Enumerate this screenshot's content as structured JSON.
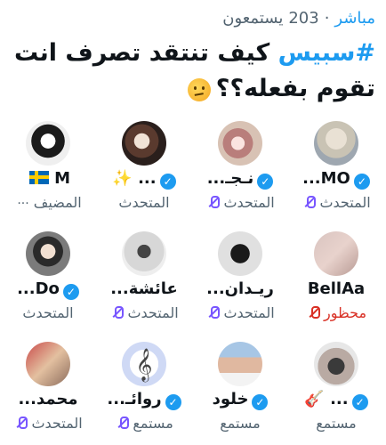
{
  "header": {
    "live_label": "مباشر",
    "separator": "·",
    "listener_count": "203",
    "listener_label": "يستمعون"
  },
  "title": {
    "hashtag": "#سبيس",
    "text_line1": " كيف تنتقد تصرف انت",
    "text_line2": "تقوم بفعله؟؟"
  },
  "participants": [
    {
      "name": "M",
      "badge": "flag-sweden",
      "role": "المضيف",
      "role_icon": "more-icon"
    },
    {
      "name": "...",
      "badge": "verified",
      "extra": "✨",
      "role": "المتحدث",
      "role_icon": "none"
    },
    {
      "name": "نـجـ...",
      "badge": "verified",
      "role": "المتحدث",
      "role_icon": "mic-off"
    },
    {
      "name": "MO...",
      "badge": "verified",
      "role": "المتحدث",
      "role_icon": "mic-off"
    },
    {
      "name": "Do...",
      "badge": "verified",
      "role": "المتحدث",
      "role_icon": "none"
    },
    {
      "name": "عائشة...",
      "badge": "none",
      "role": "المتحدث",
      "role_icon": "mic-off"
    },
    {
      "name": "ريـدان...",
      "badge": "none",
      "role": "المتحدث",
      "role_icon": "mic-off"
    },
    {
      "name": "BellAa",
      "badge": "none",
      "role": "محظور",
      "role_icon": "mic-off"
    },
    {
      "name": "محمد...",
      "badge": "none",
      "role": "المتحدث",
      "role_icon": "mic-off"
    },
    {
      "name": "روائـ...",
      "badge": "verified",
      "role": "مستمع",
      "role_icon": "mic-off"
    },
    {
      "name": "خلود",
      "badge": "verified",
      "role": "مستمع",
      "role_icon": "none"
    },
    {
      "name": "...",
      "badge": "verified",
      "extra": "🎸",
      "role": "مستمع",
      "role_icon": "none"
    }
  ],
  "colors": {
    "accent": "#1d9bf0",
    "banned": "#d93025",
    "muted_icon": "#7856ff",
    "secondary_text": "#536471"
  }
}
